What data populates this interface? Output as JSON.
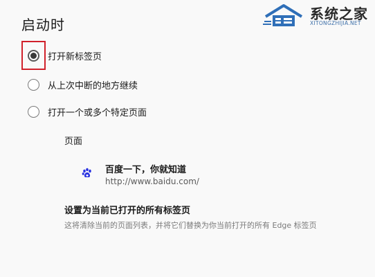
{
  "heading": "启动时",
  "watermark": {
    "name": "系统之家",
    "url": "XITONGZHIJIA.NET",
    "icon": "house-logo-icon",
    "color": "#2f6fb8"
  },
  "startup_options": [
    {
      "label": "打开新标签页",
      "checked": true
    },
    {
      "label": "从上次中断的地方继续",
      "checked": false
    },
    {
      "label": "打开一个或多个特定页面",
      "checked": false
    }
  ],
  "pages_section": {
    "label": "页面",
    "entries": [
      {
        "title": "百度一下，你就知道",
        "url": "http://www.baidu.com/",
        "icon": "baidu-paw-icon"
      }
    ]
  },
  "set_current": {
    "label": "设置为当前已打开的所有标签页",
    "description": "这将清除当前的页面列表，并将它们替换为你当前打开的所有 Edge 标签页"
  },
  "highlight_color": "#d0202a",
  "baidu_color": "#2932e1"
}
